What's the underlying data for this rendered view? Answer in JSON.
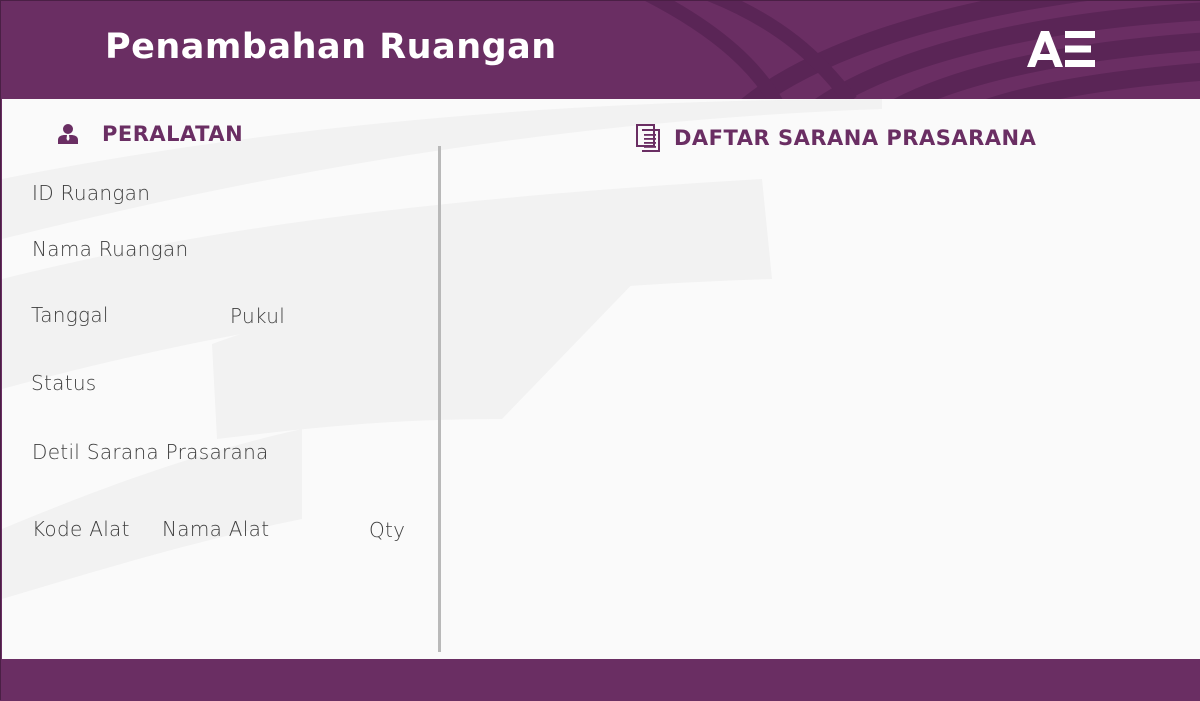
{
  "header": {
    "title": "Penambahan Ruangan",
    "logo_text": "AE"
  },
  "left_panel": {
    "heading": "PERALATAN",
    "heading_icon": "user-icon",
    "fields": {
      "id_ruangan": "ID Ruangan",
      "nama_ruangan": "Nama Ruangan",
      "tanggal": "Tanggal",
      "pukul": "Pukul",
      "status": "Status",
      "detil": "Detil Sarana Prasarana"
    },
    "table_headers": {
      "kode_alat": "Kode Alat",
      "nama_alat": "Nama Alat",
      "qty": "Qty"
    }
  },
  "right_panel": {
    "heading": "DAFTAR SARANA PRASARANA",
    "heading_icon": "document-list-icon"
  },
  "colors": {
    "brand": "#6a2e63",
    "background": "#fafafa",
    "divider": "#b9b9b9",
    "text": "#3d3d3d"
  }
}
